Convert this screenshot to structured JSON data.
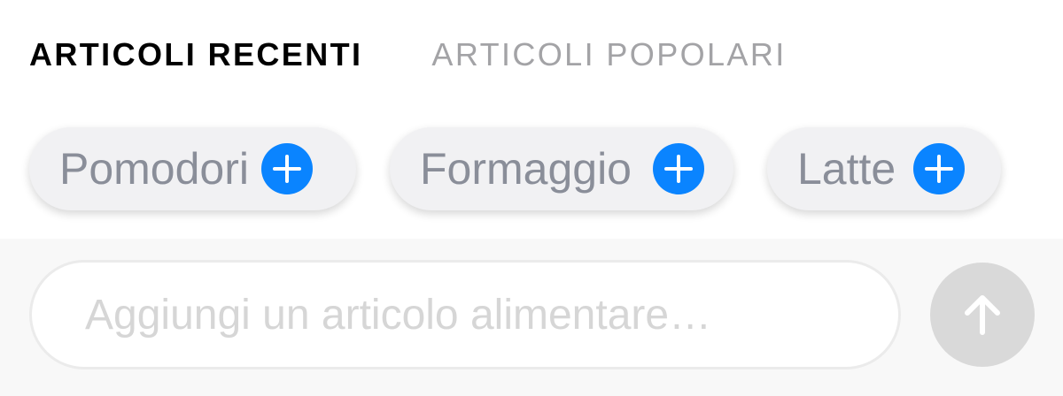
{
  "tabs": [
    {
      "label": "ARTICOLI RECENTI",
      "active": true
    },
    {
      "label": "ARTICOLI POPOLARI",
      "active": false
    }
  ],
  "chips": [
    {
      "label": "Pomodori",
      "icon": "plus-circle-icon"
    },
    {
      "label": "Formaggio",
      "icon": "plus-circle-icon"
    },
    {
      "label": "Latte",
      "icon": "plus-circle-icon"
    }
  ],
  "input": {
    "placeholder": "Aggiungi un articolo alimentare…",
    "value": ""
  },
  "send_button": {
    "icon": "arrow-up-icon",
    "enabled": false
  },
  "colors": {
    "accent": "#0a84ff",
    "active_tab": "#000000",
    "inactive_tab": "#a3a3a6",
    "chip_text": "#8a8e99",
    "send_disabled": "#d9d9d9"
  }
}
